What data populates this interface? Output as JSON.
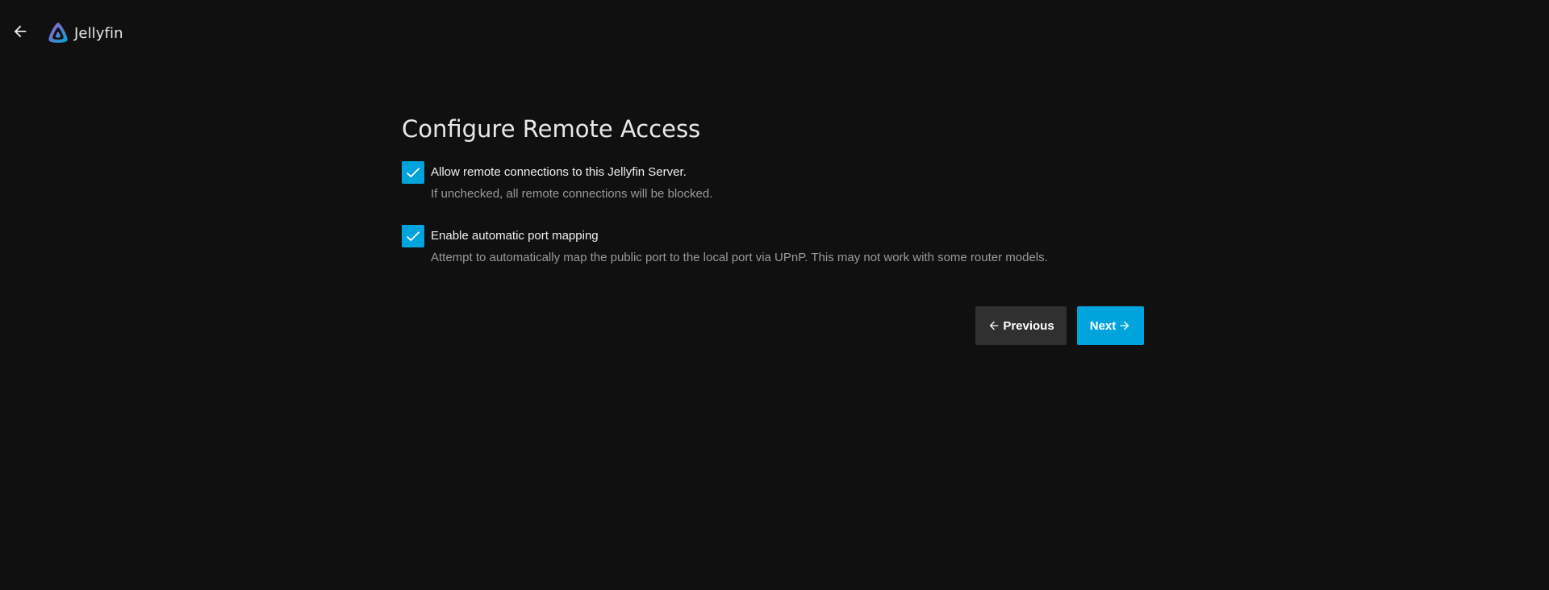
{
  "app": {
    "name": "Jellyfin"
  },
  "header": {
    "back_icon": "arrow-left-icon",
    "logo_icon": "jellyfin-logo-icon"
  },
  "page": {
    "title": "Configure Remote Access"
  },
  "options": [
    {
      "label": "Allow remote connections to this Jellyfin Server.",
      "help": "If unchecked, all remote connections will be blocked.",
      "checked": true
    },
    {
      "label": "Enable automatic port mapping",
      "help": "Attempt to automatically map the public port to the local port via UPnP. This may not work with some router models.",
      "checked": true
    }
  ],
  "buttons": {
    "previous_label": "Previous",
    "previous_icon": "arrow-left-icon",
    "next_label": "Next",
    "next_icon": "arrow-right-icon"
  },
  "colors": {
    "background": "#101010",
    "accent": "#00a4dc",
    "secondary_button": "#303030",
    "help_text": "#9a9a9a"
  }
}
